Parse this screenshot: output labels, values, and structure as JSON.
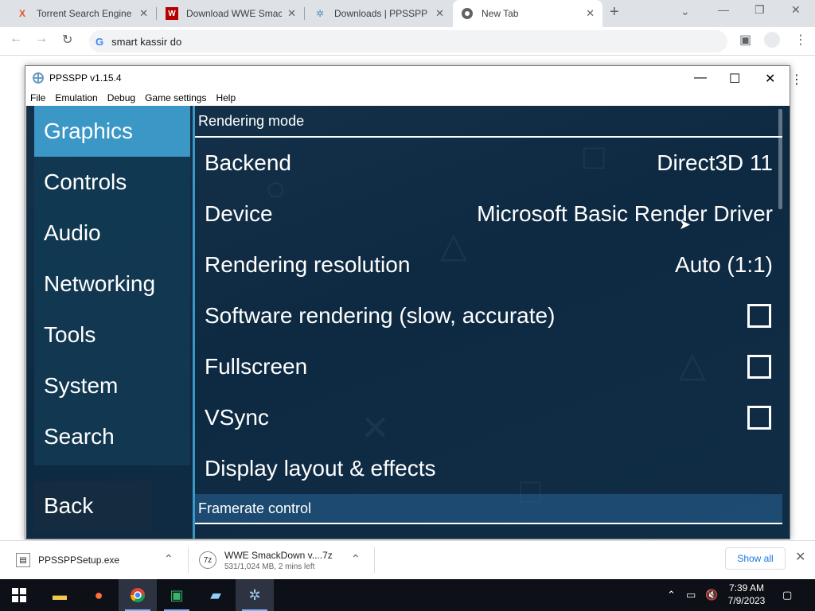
{
  "browser": {
    "tabs": [
      {
        "label": "Torrent Search Engine",
        "icon": "x-logo-icon",
        "color": "#e8542a"
      },
      {
        "label": "Download WWE Smack",
        "icon": "wwe-logo-icon",
        "color": "#b50000"
      },
      {
        "label": "Downloads | PPSSPP",
        "icon": "ppsspp-icon",
        "color": "#5b8fb5"
      },
      {
        "label": "New Tab",
        "icon": "chrome-icon",
        "color": "#5f6368"
      }
    ],
    "new_tab": "+",
    "omnibox_text": "smart kassir do"
  },
  "ppsspp": {
    "title": "PPSSPP v1.15.4",
    "menu": [
      "File",
      "Emulation",
      "Debug",
      "Game settings",
      "Help"
    ],
    "nav": [
      "Graphics",
      "Controls",
      "Audio",
      "Networking",
      "Tools",
      "System",
      "Search"
    ],
    "back_label": "Back",
    "section_rendering": "Rendering mode",
    "rows": [
      {
        "label": "Backend",
        "value": "Direct3D 11"
      },
      {
        "label": "Device",
        "value": "Microsoft Basic Render Driver"
      },
      {
        "label": "Rendering resolution",
        "value": "Auto (1:1)"
      }
    ],
    "checks": [
      {
        "label": "Software rendering (slow, accurate)",
        "checked": false
      },
      {
        "label": "Fullscreen",
        "checked": false
      },
      {
        "label": "VSync",
        "checked": false
      }
    ],
    "display_layout": "Display layout & effects",
    "section_framerate": "Framerate control",
    "accent": "#3a97c6"
  },
  "downloads": {
    "items": [
      {
        "name": "PPSSPPSetup.exe",
        "status": ""
      },
      {
        "name": "WWE SmackDown v....7z",
        "status": "531/1,024 MB, 2 mins left"
      }
    ],
    "show_all": "Show all"
  },
  "taskbar": {
    "time": "7:39 AM",
    "date": "7/9/2023"
  }
}
